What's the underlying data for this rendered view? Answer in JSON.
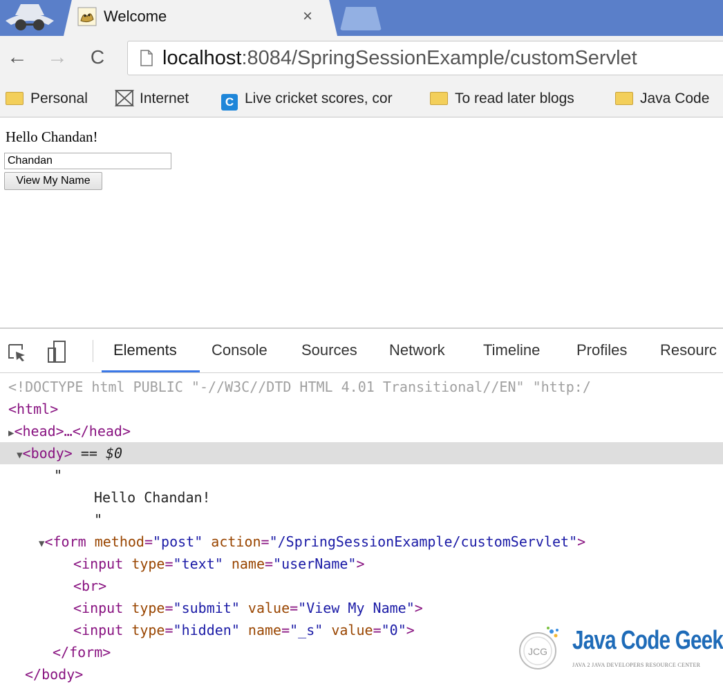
{
  "tab": {
    "title": "Welcome",
    "close_glyph": "×"
  },
  "toolbar": {
    "back_glyph": "←",
    "forward_glyph": "→",
    "reload_glyph": "C",
    "url_host": "localhost",
    "url_rest": ":8084/SpringSessionExample/customServlet"
  },
  "bookmarks": [
    {
      "label": "Personal",
      "icon": "folder-icon"
    },
    {
      "label": "Internet",
      "icon": "internet-icon"
    },
    {
      "label": "Live cricket scores, cor",
      "icon": "cricket-icon",
      "icon_glyph": "C"
    },
    {
      "label": "To read later blogs",
      "icon": "folder-icon"
    },
    {
      "label": "Java Code",
      "icon": "folder-icon"
    }
  ],
  "page": {
    "greeting": "Hello Chandan!",
    "input_value": "Chandan",
    "button_label": "View My Name"
  },
  "devtools": {
    "tabs": [
      "Elements",
      "Console",
      "Sources",
      "Network",
      "Timeline",
      "Profiles",
      "Resourc"
    ],
    "active_tab": "Elements",
    "doctype": "<!DOCTYPE html PUBLIC \"-//W3C//DTD HTML 4.01 Transitional//EN\" \"http:/",
    "html_open": "<html>",
    "head_collapsed": "<head>…</head>",
    "body_open": "<body>",
    "body_marker": "== $0",
    "quote": "\"",
    "text_node": "Hello Chandan!",
    "form_tag": "form",
    "form_method_attr": "method",
    "form_method_val": "\"post\"",
    "form_action_attr": "action",
    "form_action_val": "\"/SpringSessionExample/customServlet\"",
    "input1": {
      "type": "\"text\"",
      "name": "\"userName\""
    },
    "br": "<br>",
    "input2": {
      "type": "\"submit\"",
      "value": "\"View My Name\""
    },
    "input3": {
      "type": "\"hidden\"",
      "name": "\"_s\"",
      "value": "\"0\""
    },
    "form_close": "</form>",
    "body_close": "</body>"
  },
  "logo": {
    "title": "Java Code Geeks",
    "subtitle": "JAVA 2 JAVA DEVELOPERS RESOURCE CENTER",
    "mark": "JCG"
  }
}
